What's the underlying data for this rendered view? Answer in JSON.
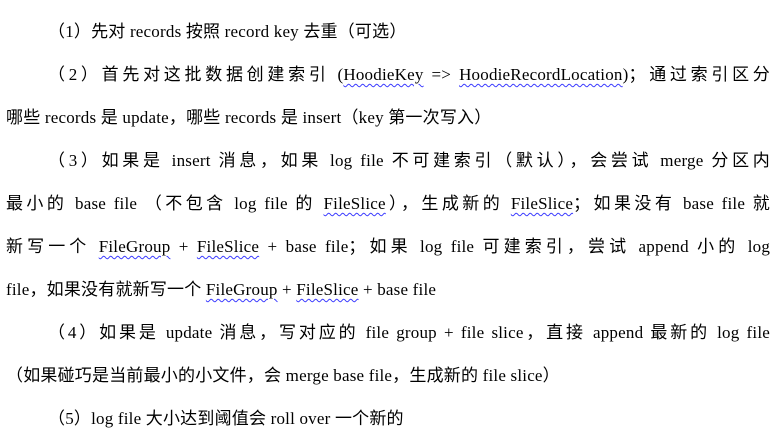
{
  "document": {
    "lines": [
      "（1）先对  records  按照  record key  去重（可选）",
      "（2）首先对这批数据创建索引 (HoodieKey => HoodieRecordLocation)；通过索引区分",
      "哪些  records  是  update，哪些  records  是  insert（key  第一次写入）",
      "（3）如果是  insert  消息，如果  log file  不可建索引（默认），会尝试  merge  分区内",
      "最小的  base file （不包含  log file  的  FileSlice），生成新的  FileSlice；如果没有  base file  就",
      "新写一个  FileGroup + FileSlice + base file；如果   log file  可建索引，尝试  append  小的  log",
      "file，如果没有就新写一个    FileGroup + FileSlice + base file",
      "（4）如果是  update  消息，写对应的  file group + file slice，直接  append  最新的  log file",
      "（如果碰巧是当前最小的小文件，会  merge base file，生成新的  file slice）",
      "（5）log file  大小达到阈值会  roll over  一个新的"
    ]
  }
}
